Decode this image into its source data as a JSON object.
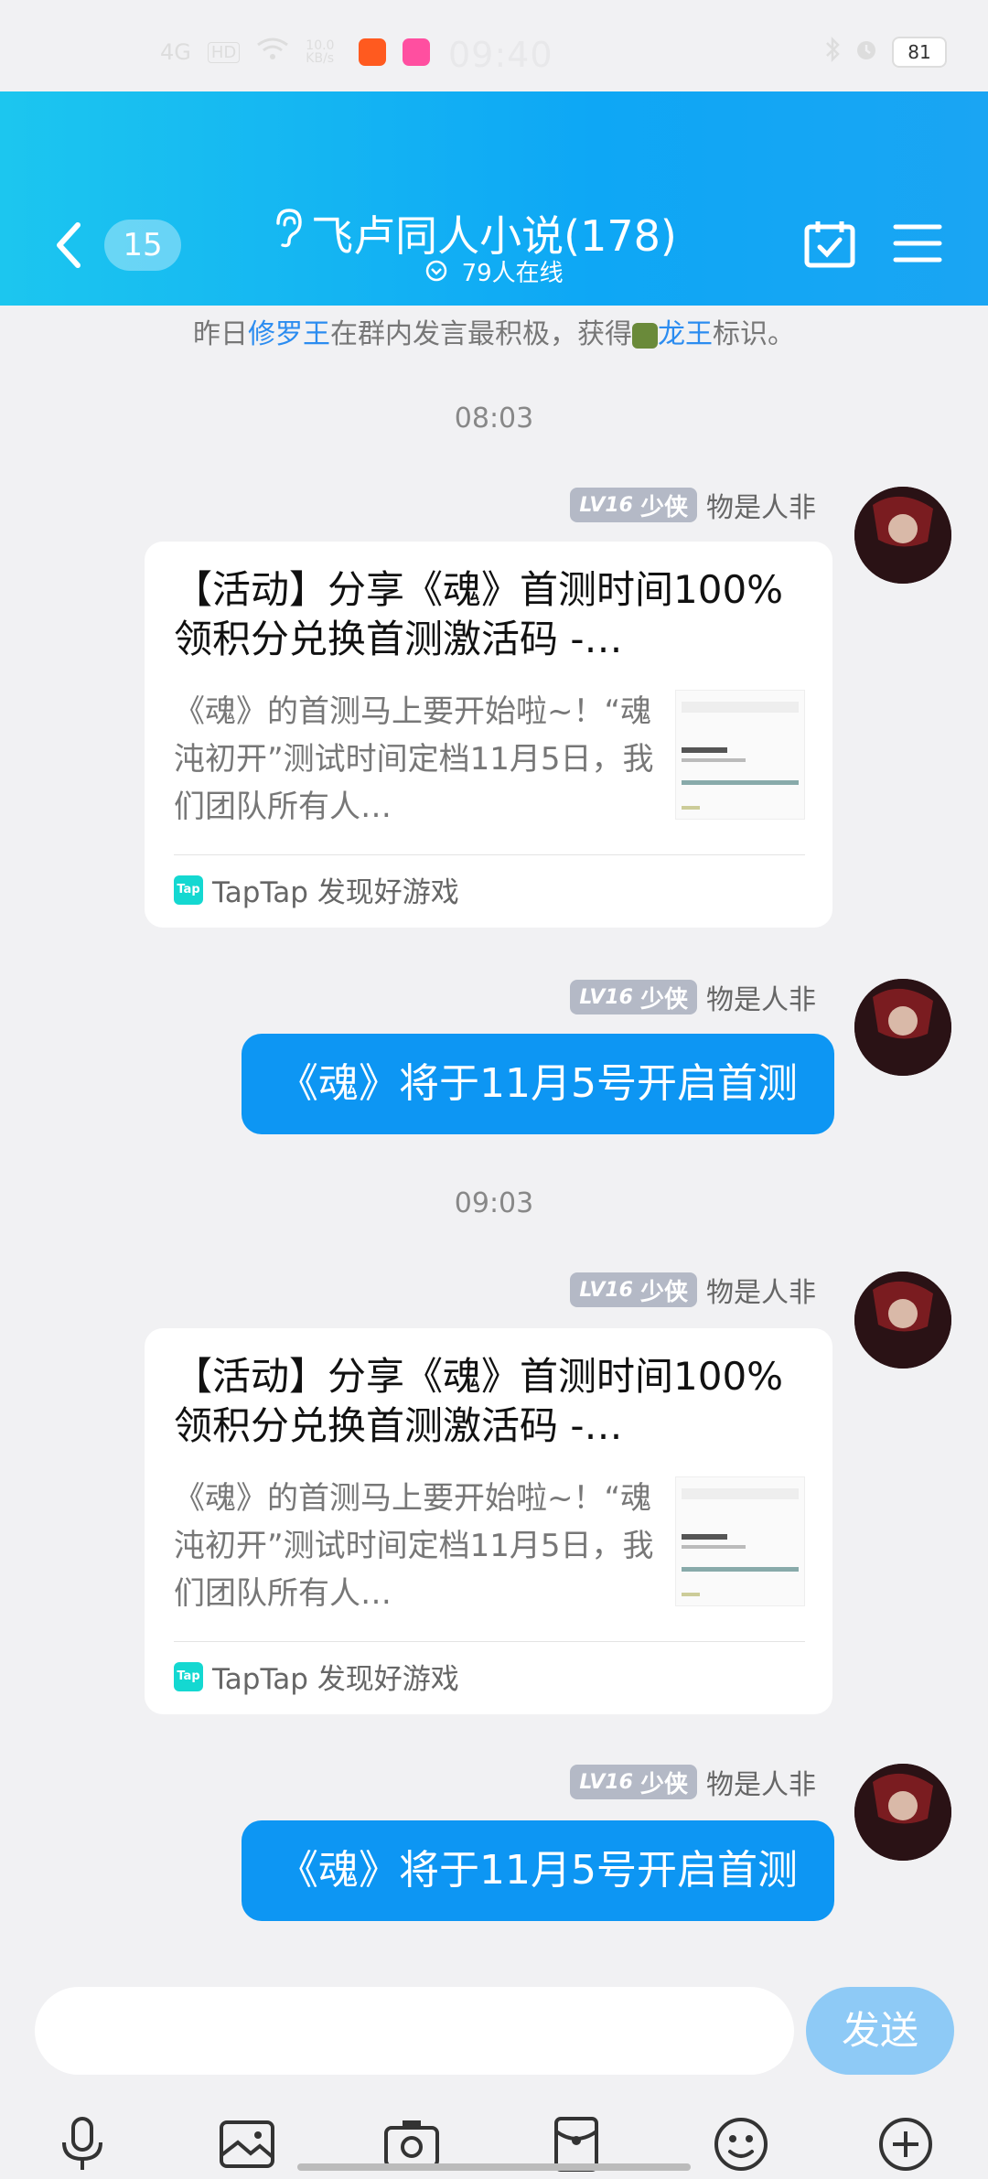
{
  "status_bar": {
    "time": "09:40",
    "network": "4G",
    "hd": "HD",
    "speed": "10.0 KB/s",
    "battery": "81"
  },
  "header": {
    "unread_count": "15",
    "group_title": "飞卢同人小说(178)",
    "online_text": "79人在线"
  },
  "system_message": {
    "prefix": "昨日",
    "user": "修罗王",
    "middle": "在群内发言最积极，获得",
    "badge": "龙王",
    "suffix": "标识。"
  },
  "messages": [
    {
      "time": "08:03",
      "level": "LV16",
      "rank": "少侠",
      "sender": "物是人非",
      "card": {
        "title": "【活动】分享《魂》首测时间100%领积分兑换首测激活码 -…",
        "description": "《魂》的首测马上要开始啦~！“魂沌初开”测试时间定档11月5日，我们团队所有人…",
        "source": "TapTap 发现好游戏",
        "logo": "Tap"
      }
    },
    {
      "level": "LV16",
      "rank": "少侠",
      "sender": "物是人非",
      "text": "《魂》将于11月5号开启首测"
    },
    {
      "time": "09:03",
      "level": "LV16",
      "rank": "少侠",
      "sender": "物是人非",
      "card": {
        "title": "【活动】分享《魂》首测时间100%领积分兑换首测激活码 -…",
        "description": "《魂》的首测马上要开始啦~！“魂沌初开”测试时间定档11月5日，我们团队所有人…",
        "source": "TapTap 发现好游戏",
        "logo": "Tap"
      }
    },
    {
      "level": "LV16",
      "rank": "少侠",
      "sender": "物是人非",
      "text": "《魂》将于11月5号开启首测"
    }
  ],
  "input": {
    "placeholder": "",
    "send_label": "发送"
  },
  "toolbar_icons": [
    "microphone-icon",
    "image-icon",
    "camera-icon",
    "red-packet-icon",
    "emoji-icon",
    "plus-icon"
  ],
  "colors": {
    "header_start": "#1cc6ef",
    "header_end": "#0ea7f5",
    "bubble": "#0d96f3",
    "send_button": "#8ecaf6",
    "highlight_link": "#2b8cf0"
  }
}
